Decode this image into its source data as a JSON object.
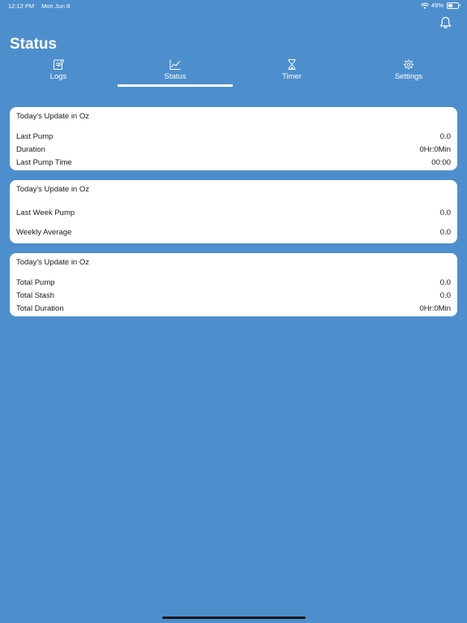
{
  "status_bar": {
    "time": "12:12 PM",
    "date": "Mon Jun 8",
    "battery": "49%",
    "battery_level": 0.49
  },
  "page": {
    "title": "Status"
  },
  "tabs": [
    {
      "label": "Logs",
      "icon": "edit-icon",
      "active": false
    },
    {
      "label": "Status",
      "icon": "chart-icon",
      "active": true
    },
    {
      "label": "Timer",
      "icon": "hourglass-icon",
      "active": false
    },
    {
      "label": "Settings",
      "icon": "gear-icon",
      "active": false
    }
  ],
  "cards": [
    {
      "title": "Today's Update in Oz",
      "rows": [
        {
          "label": "Last Pump",
          "value": "0.0"
        },
        {
          "label": "Duration",
          "value": "0Hr:0Min"
        },
        {
          "label": "Last Pump Time",
          "value": "00:00"
        }
      ]
    },
    {
      "title": "Today's Update in Oz",
      "rows": [
        {
          "label": "Last Week Pump",
          "value": "0.0"
        },
        {
          "label": "Weekly Average",
          "value": "0.0"
        }
      ]
    },
    {
      "title": "Today's Update in Oz",
      "rows": [
        {
          "label": "Total Pump",
          "value": "0.0"
        },
        {
          "label": "Total Stash",
          "value": "0.0"
        },
        {
          "label": "Total Duration",
          "value": "0Hr:0Min"
        }
      ]
    }
  ],
  "colors": {
    "background": "#4d8fcd",
    "card": "#ffffff",
    "text_dark": "#1a1a1a"
  }
}
